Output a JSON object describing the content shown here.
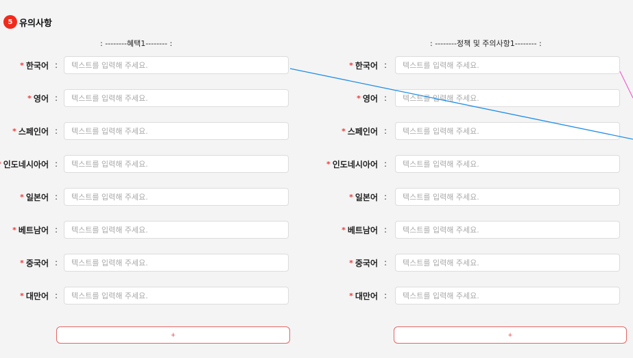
{
  "section": {
    "number": "5",
    "title": "유의사항"
  },
  "columns": [
    {
      "title": ": --------혜택1-------- :",
      "add_label": "+"
    },
    {
      "title": ": --------정책 및 주의사항1-------- :",
      "add_label": "+"
    }
  ],
  "languages": [
    "한국어",
    "영어",
    "스페인어",
    "인도네시아어",
    "일본어",
    "베트남어",
    "중국어",
    "대만어"
  ],
  "required_mark": "*",
  "colon": ":",
  "placeholder": "텍스트를 입력해 주세요.",
  "colors": {
    "badge": "#f02a1c",
    "required": "#f03a3a",
    "button_border": "#e56464",
    "connector_blue": "#1f8ee8",
    "connector_pink": "#f06ad0"
  }
}
